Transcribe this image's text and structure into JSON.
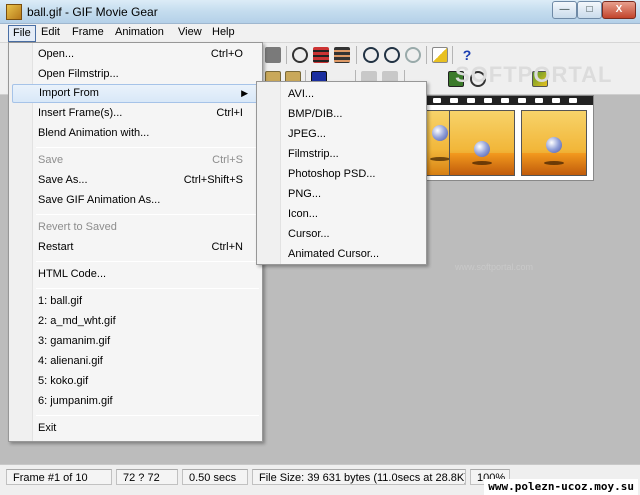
{
  "window": {
    "title": "ball.gif - GIF Movie Gear",
    "min_glyph": "—",
    "max_glyph": "□",
    "close_glyph": "X"
  },
  "menubar": [
    "File",
    "Edit",
    "Frame",
    "Animation",
    "View",
    "Help"
  ],
  "toolbar": {
    "help_glyph": "?"
  },
  "file_menu": {
    "open": {
      "label": "Open...",
      "shortcut": "Ctrl+O"
    },
    "open_filmstrip": {
      "label": "Open Filmstrip..."
    },
    "import_from": {
      "label": "Import From",
      "arrow": "▶"
    },
    "insert_frames": {
      "label": "Insert Frame(s)...",
      "shortcut": "Ctrl+I"
    },
    "blend": {
      "label": "Blend Animation with..."
    },
    "save": {
      "label": "Save",
      "shortcut": "Ctrl+S"
    },
    "save_as": {
      "label": "Save As...",
      "shortcut": "Ctrl+Shift+S"
    },
    "save_gif": {
      "label": "Save GIF Animation As..."
    },
    "revert": {
      "label": "Revert to Saved"
    },
    "restart": {
      "label": "Restart",
      "shortcut": "Ctrl+N"
    },
    "html_code": {
      "label": "HTML Code..."
    },
    "recent": [
      "1: ball.gif",
      "2: a_md_wht.gif",
      "3: gamanim.gif",
      "4: alienani.gif",
      "5: koko.gif",
      "6: jumpanim.gif"
    ],
    "exit": {
      "label": "Exit"
    }
  },
  "import_submenu": [
    "AVI...",
    "BMP/DIB...",
    "JPEG...",
    "Filmstrip...",
    "Photoshop PSD...",
    "PNG...",
    "Icon...",
    "Cursor...",
    "Animated Cursor..."
  ],
  "watermark": {
    "main": "SOFTPORTAL",
    "sub": "www.softportal.com"
  },
  "statusbar": {
    "frame": "Frame #1 of 10",
    "dims": "72 ? 72",
    "delay": "0.50 secs",
    "filesize": "File Size: 39 631 bytes  (11.0secs at 28.8K)",
    "zoom": "100%"
  },
  "site": "www.polezn-ucoz.moy.su",
  "colors": {
    "highlight": "#d9e8f8",
    "frame_bg": "#f2b73a",
    "workspace": "#bcbcbc"
  }
}
